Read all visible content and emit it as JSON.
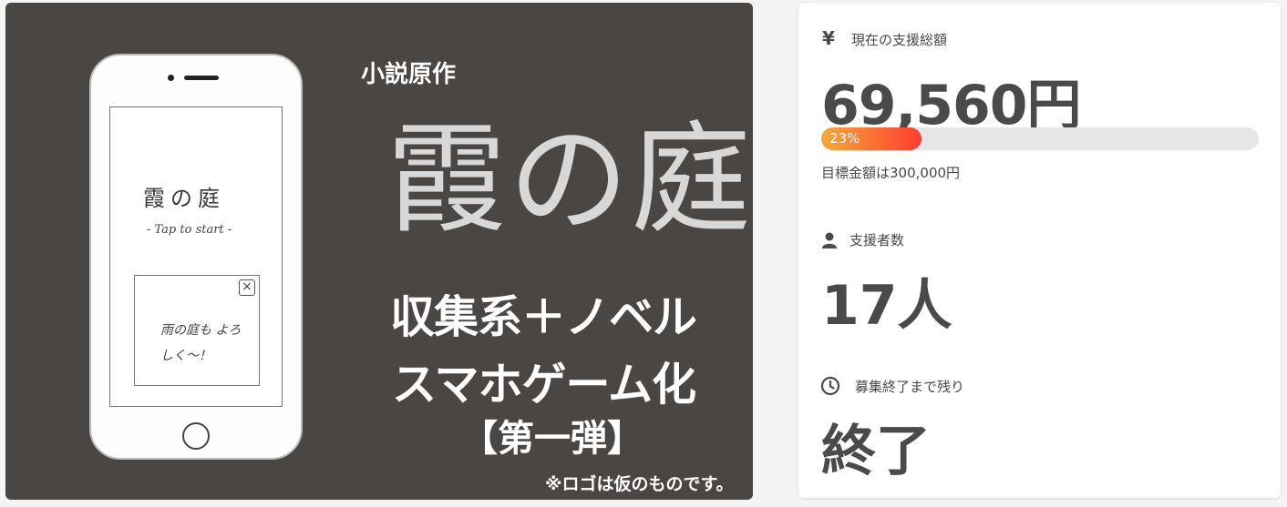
{
  "hero": {
    "phone_title": "霞の庭",
    "phone_tap": "- Tap to start -",
    "phone_dialog_close": "×",
    "phone_dialog_text": "雨の庭も よろしく〜！",
    "subtitle": "小説原作",
    "title": "霞の庭",
    "line1": "収集系＋ノベル",
    "line2": "スマホゲーム化",
    "line3": "【第一弾】",
    "note": "※ロゴは仮のものです。"
  },
  "stats": {
    "total": {
      "icon": "yen-icon",
      "icon_glyph": "¥",
      "label": "現在の支援総額",
      "value": "69,560円",
      "progress_percent": 23,
      "progress_label": "23%",
      "goal": "目標金額は300,000円"
    },
    "supporters": {
      "icon": "person-icon",
      "label": "支援者数",
      "value": "17人"
    },
    "remaining": {
      "icon": "clock-icon",
      "label": "募集終了まで残り",
      "value": "終了"
    }
  },
  "colors": {
    "progress_start": "#f6a93b",
    "progress_end": "#ff3c2f",
    "hero_bg": "#4a4644"
  }
}
